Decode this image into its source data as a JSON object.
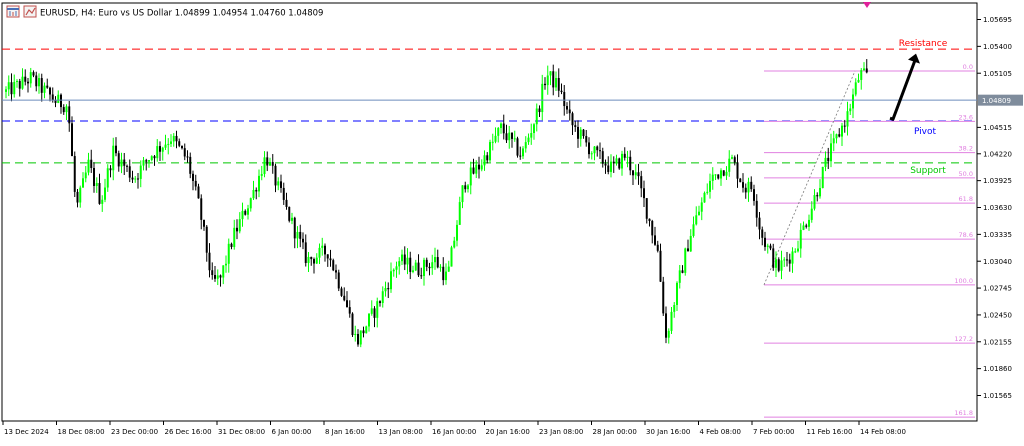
{
  "header": {
    "title": "EURUSD, H4:  Euro vs US Dollar  1.04899 1.04954 1.04760 1.04809",
    "icons": [
      "chart-window-icon",
      "indicator-window-icon"
    ]
  },
  "colors": {
    "bull": "#00ff00",
    "bear": "#000000",
    "resistance": "#ff0000",
    "pivot": "#0000ff",
    "support": "#00c800",
    "price_line": "#6c8cbc",
    "fib": "#e080e0",
    "arrow": "#000000",
    "price_badge": "#7f8c9c"
  },
  "chart_data": {
    "type": "candlestick",
    "symbol": "EURUSD",
    "timeframe": "H4",
    "ohlc": {
      "open": 1.04899,
      "high": 1.04954,
      "low": 1.0476,
      "close": 1.04809
    },
    "current_price": 1.04809,
    "current_price_label": "1.04809",
    "ylim": [
      1.0126,
      1.0585
    ],
    "y_ticks": [
      {
        "v": 1.05695,
        "label": "1.05695"
      },
      {
        "v": 1.054,
        "label": "1.05400"
      },
      {
        "v": 1.05105,
        "label": "1.05105"
      },
      {
        "v": 1.0451,
        "label": "1.04515"
      },
      {
        "v": 1.0422,
        "label": "1.04220"
      },
      {
        "v": 1.03925,
        "label": "1.03925"
      },
      {
        "v": 1.0363,
        "label": "1.03630"
      },
      {
        "v": 1.03335,
        "label": "1.03335"
      },
      {
        "v": 1.0304,
        "label": "1.03040"
      },
      {
        "v": 1.02745,
        "label": "1.02745"
      },
      {
        "v": 1.0245,
        "label": "1.02450"
      },
      {
        "v": 1.02155,
        "label": "1.02155"
      },
      {
        "v": 1.0186,
        "label": "1.01860"
      },
      {
        "v": 1.01565,
        "label": "1.01565"
      }
    ],
    "x_labels": [
      "13 Dec 2024",
      "18 Dec 08:00",
      "23 Dec 00:00",
      "26 Dec 16:00",
      "31 Dec 08:00",
      "6 Jan 00:00",
      "8 Jan 16:00",
      "13 Jan 08:00",
      "16 Jan 00:00",
      "20 Jan 16:00",
      "23 Jan 08:00",
      "28 Jan 00:00",
      "30 Jan 16:00",
      "4 Feb 08:00",
      "7 Feb 00:00",
      "11 Feb 16:00",
      "14 Feb 08:00"
    ],
    "price_path": [
      [
        0,
        1.049
      ],
      [
        3,
        1.0505
      ],
      [
        6,
        1.048
      ],
      [
        7.5,
        1.0475
      ],
      [
        8.5,
        1.036
      ],
      [
        10,
        1.041
      ],
      [
        11.5,
        1.037
      ],
      [
        13,
        1.0425
      ],
      [
        15.5,
        1.0395
      ],
      [
        17.5,
        1.042
      ],
      [
        20,
        1.044
      ],
      [
        22,
        1.0415
      ],
      [
        23.5,
        1.036
      ],
      [
        25,
        1.028
      ],
      [
        26,
        1.0285
      ],
      [
        27.5,
        1.033
      ],
      [
        30,
        1.038
      ],
      [
        31.5,
        1.042
      ],
      [
        34,
        1.036
      ],
      [
        36.5,
        1.0305
      ],
      [
        39,
        1.0315
      ],
      [
        41,
        1.0265
      ],
      [
        42.5,
        1.0215
      ],
      [
        45,
        1.0255
      ],
      [
        47.5,
        1.0305
      ],
      [
        50,
        1.0295
      ],
      [
        52,
        1.0305
      ],
      [
        53.5,
        1.0285
      ],
      [
        55.5,
        1.039
      ],
      [
        57.5,
        1.041
      ],
      [
        60,
        1.045
      ],
      [
        62.5,
        1.042
      ],
      [
        64.5,
        1.047
      ],
      [
        65.5,
        1.051
      ],
      [
        67,
        1.0495
      ],
      [
        68.5,
        1.0455
      ],
      [
        71,
        1.0425
      ],
      [
        73.5,
        1.0405
      ],
      [
        75,
        1.042
      ],
      [
        76.5,
        1.0395
      ],
      [
        77.5,
        1.0365
      ],
      [
        79,
        1.0315
      ],
      [
        80,
        1.022
      ],
      [
        81.5,
        1.028
      ],
      [
        83,
        1.0335
      ],
      [
        85.5,
        1.0395
      ],
      [
        88,
        1.0415
      ],
      [
        89.5,
        1.0385
      ],
      [
        90.5,
        1.0385
      ],
      [
        91.5,
        1.0335
      ],
      [
        93.5,
        1.0295
      ],
      [
        95.5,
        1.0315
      ],
      [
        97.5,
        1.036
      ],
      [
        99.5,
        1.0415
      ],
      [
        102,
        1.0465
      ],
      [
        103.5,
        1.051
      ],
      [
        104.5,
        1.0505
      ],
      [
        105,
        1.0481
      ]
    ],
    "levels": [
      {
        "key": "resistance",
        "value": 1.0537,
        "label": "Resistance",
        "color": "#ff0000"
      },
      {
        "key": "pivot",
        "value": 1.0458,
        "label": "Pivot",
        "color": "#0000ff"
      },
      {
        "key": "support",
        "value": 1.0412,
        "label": "Support",
        "color": "#00c800"
      }
    ],
    "fibonacci": {
      "from_price": 1.0278,
      "to_price": 1.0513,
      "color": "#e080e0",
      "levels": [
        {
          "ratio": 0.0,
          "label": "0.0"
        },
        {
          "ratio": 0.236,
          "label": "23.6"
        },
        {
          "ratio": 0.382,
          "label": "38.2"
        },
        {
          "ratio": 0.5,
          "label": "50.0"
        },
        {
          "ratio": 0.618,
          "label": "61.8"
        },
        {
          "ratio": 0.786,
          "label": "78.6"
        },
        {
          "ratio": 1.0,
          "label": "100.0"
        },
        {
          "ratio": 1.272,
          "label": "127.2"
        },
        {
          "ratio": 1.618,
          "label": "161.8"
        }
      ]
    },
    "arrow": {
      "from_price": 1.046,
      "to_price": 1.0532,
      "direction": "up"
    }
  }
}
